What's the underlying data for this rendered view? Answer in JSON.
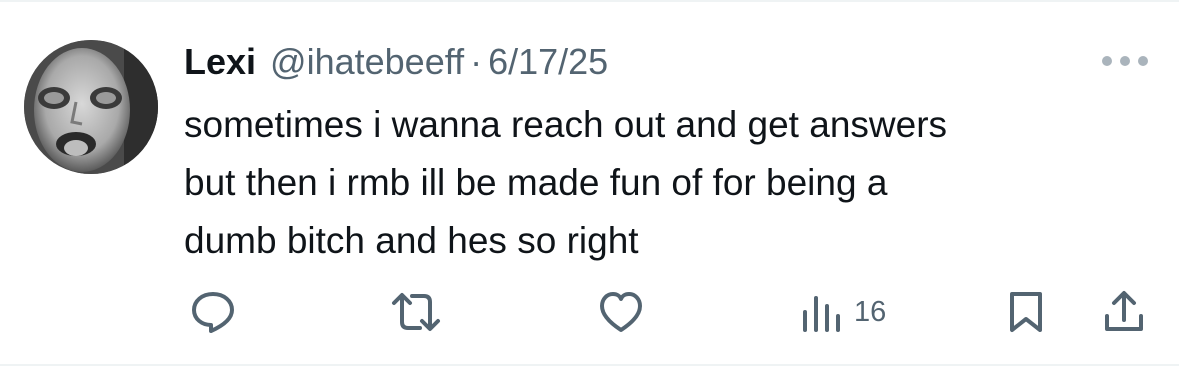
{
  "tweet": {
    "author": {
      "display_name": "Lexi",
      "handle": "@ihatebeeff",
      "avatar_icon": "avatar-photo"
    },
    "separator": "·",
    "date": "6/17/25",
    "text_lines": [
      "sometimes i wanna reach out and get answers",
      "but then i rmb ill be made fun of for being a",
      "dumb bitch and hes so right"
    ],
    "actions": {
      "reply_icon": "reply-icon",
      "retweet_icon": "retweet-icon",
      "like_icon": "heart-icon",
      "views_icon": "views-icon",
      "views_count": "16",
      "bookmark_icon": "bookmark-icon",
      "share_icon": "share-icon"
    },
    "more_icon": "more-icon"
  },
  "colors": {
    "text_primary": "#0f1419",
    "text_secondary": "#536471",
    "divider": "#eff3f4"
  }
}
